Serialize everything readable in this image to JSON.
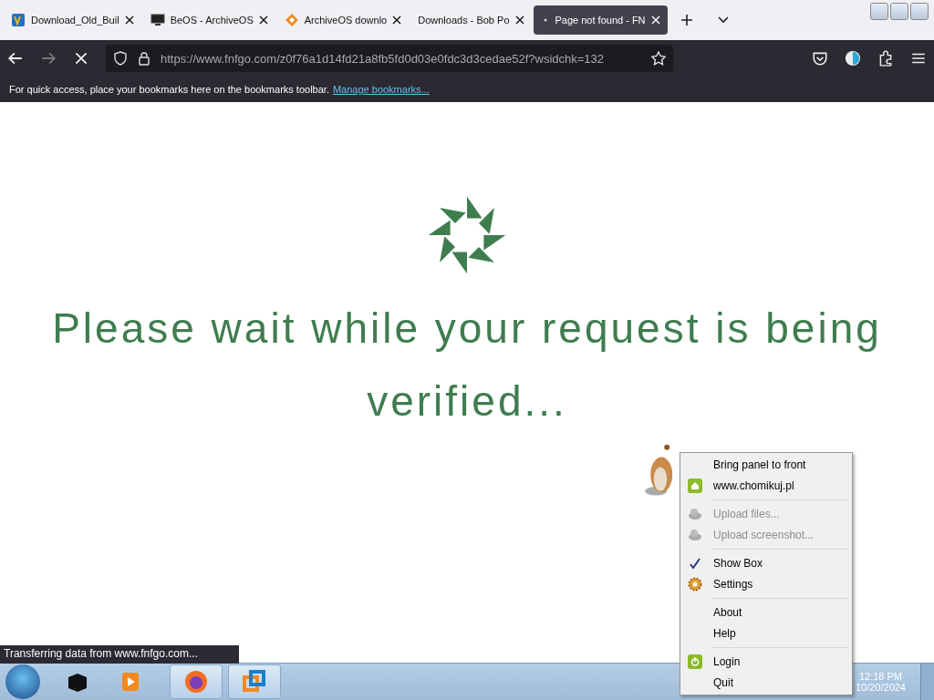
{
  "tabs": [
    {
      "title": "Download_Old_Buil",
      "selected": false
    },
    {
      "title": "BeOS - ArchiveOS",
      "selected": false
    },
    {
      "title": "ArchiveOS downlo",
      "selected": false
    },
    {
      "title": "Downloads - Bob Po",
      "selected": false
    },
    {
      "title": "Page not found - FN",
      "selected": true
    }
  ],
  "address": {
    "url": "https://www.fnfgo.com/z0f76a1d14fd21a8fb5fd0d03e0fdc3d3cedae52f?wsidchk=132"
  },
  "bookmarks_bar": {
    "text": "For quick access, place your bookmarks here on the bookmarks toolbar.",
    "link": "Manage bookmarks..."
  },
  "page": {
    "message": "Please wait while your request is being verified..."
  },
  "status": "Transferring data from www.fnfgo.com...",
  "context_menu": [
    {
      "kind": "item",
      "label": "Bring panel to front",
      "disabled": false,
      "checked": false
    },
    {
      "kind": "item",
      "label": "www.chomikuj.pl",
      "disabled": false,
      "checked": false
    },
    {
      "kind": "separator"
    },
    {
      "kind": "item",
      "label": "Upload files...",
      "disabled": true,
      "checked": false
    },
    {
      "kind": "item",
      "label": "Upload screenshot...",
      "disabled": true,
      "checked": false
    },
    {
      "kind": "separator"
    },
    {
      "kind": "item",
      "label": "Show Box",
      "disabled": false,
      "checked": true
    },
    {
      "kind": "item",
      "label": "Settings",
      "disabled": false,
      "checked": false
    },
    {
      "kind": "separator"
    },
    {
      "kind": "item",
      "label": "About",
      "disabled": false,
      "checked": false
    },
    {
      "kind": "item",
      "label": "Help",
      "disabled": false,
      "checked": false
    },
    {
      "kind": "separator"
    },
    {
      "kind": "item",
      "label": "Login",
      "disabled": false,
      "checked": false
    },
    {
      "kind": "item",
      "label": "Quit",
      "disabled": false,
      "checked": false
    }
  ],
  "clock": {
    "time": "12:18 PM",
    "date": "10/20/2024"
  }
}
